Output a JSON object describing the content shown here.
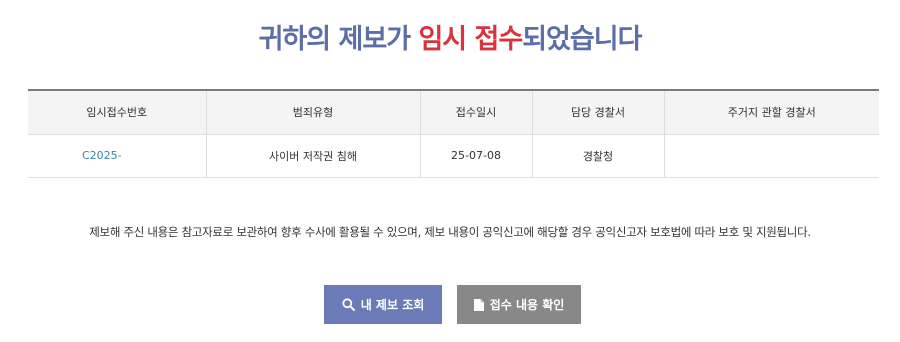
{
  "title": {
    "part1": "귀하의 제보가 ",
    "highlight": "임시 접수",
    "part2": "되었습니다",
    "text_color": "#5b6ea5",
    "highlight_color": "#d9343d"
  },
  "table": {
    "headers": [
      "임시접수번호",
      "범죄유형",
      "접수일시",
      "담당 경찰서",
      "주거지 관할 경찰서"
    ],
    "row": {
      "receipt_no": "C2025-",
      "crime_type": "사이버 저작권 침해",
      "received_date": "25-07-08",
      "station": "경찰청",
      "residence_station": ""
    }
  },
  "notice": "제보해 주신 내용은 참고자료로 보관하여 향후 수사에 활용될 수 있으며, 제보 내용이 공익신고에 해당할 경우 공익신고자 보호법에 따라 보호 및 지원됩니다.",
  "buttons": {
    "inquiry": {
      "label": "내 제보 조회",
      "icon": "search-icon",
      "color": "#6a7bb7"
    },
    "confirm": {
      "label": "접수 내용 확인",
      "icon": "document-icon",
      "color": "#888888"
    }
  }
}
